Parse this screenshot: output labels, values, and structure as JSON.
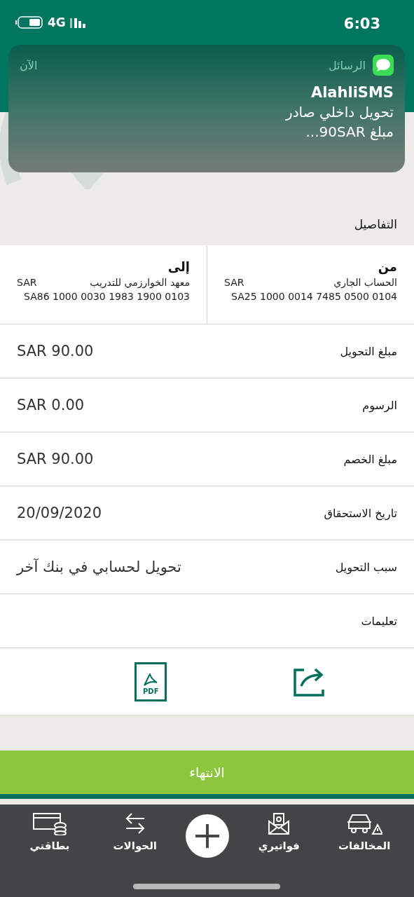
{
  "status_bar": {
    "time": "6:03",
    "network": "4G"
  },
  "notification": {
    "app": "الرسائل",
    "time": "الآن",
    "sender": "AlahliSMS",
    "lines": [
      "تحويل داخلي صادر",
      "مبلغ 90SAR..."
    ]
  },
  "section_title": "التفاصيل",
  "transfer": [
    {
      "heading": "من",
      "account": "الحساب الجاري",
      "currency": "SAR",
      "iban": "SA25 1000 0014 7485 0500 0104"
    },
    {
      "heading": "إلى",
      "account": "معهد الخوارزمي للتدريب",
      "currency": "SAR",
      "iban": "SA86 1000 0030 1983 1900 0103"
    }
  ],
  "details": [
    {
      "label": "مبلغ التحويل",
      "value": "SAR 90.00"
    },
    {
      "label": "الرسوم",
      "value": "SAR 0.00"
    },
    {
      "label": "مبلغ الخصم",
      "value": "SAR 90.00"
    },
    {
      "label": "تاريخ الاستحقاق",
      "value": "20/09/2020"
    },
    {
      "label": "سبب التحويل",
      "value": "تحويل لحسابي في بنك آخر"
    },
    {
      "label": "تعليمات"
    }
  ],
  "actions": {
    "pdf_label": "PDF"
  },
  "finish_button": "الانتهاء",
  "tab_bar": [
    {
      "kind": "violations",
      "label": "المخالفات"
    },
    {
      "kind": "bills",
      "label": "فواتيري"
    },
    {
      "kind": "add"
    },
    {
      "kind": "transfers",
      "label": "الحوالات"
    },
    {
      "kind": "cards",
      "label": "بطاقتي"
    }
  ]
}
